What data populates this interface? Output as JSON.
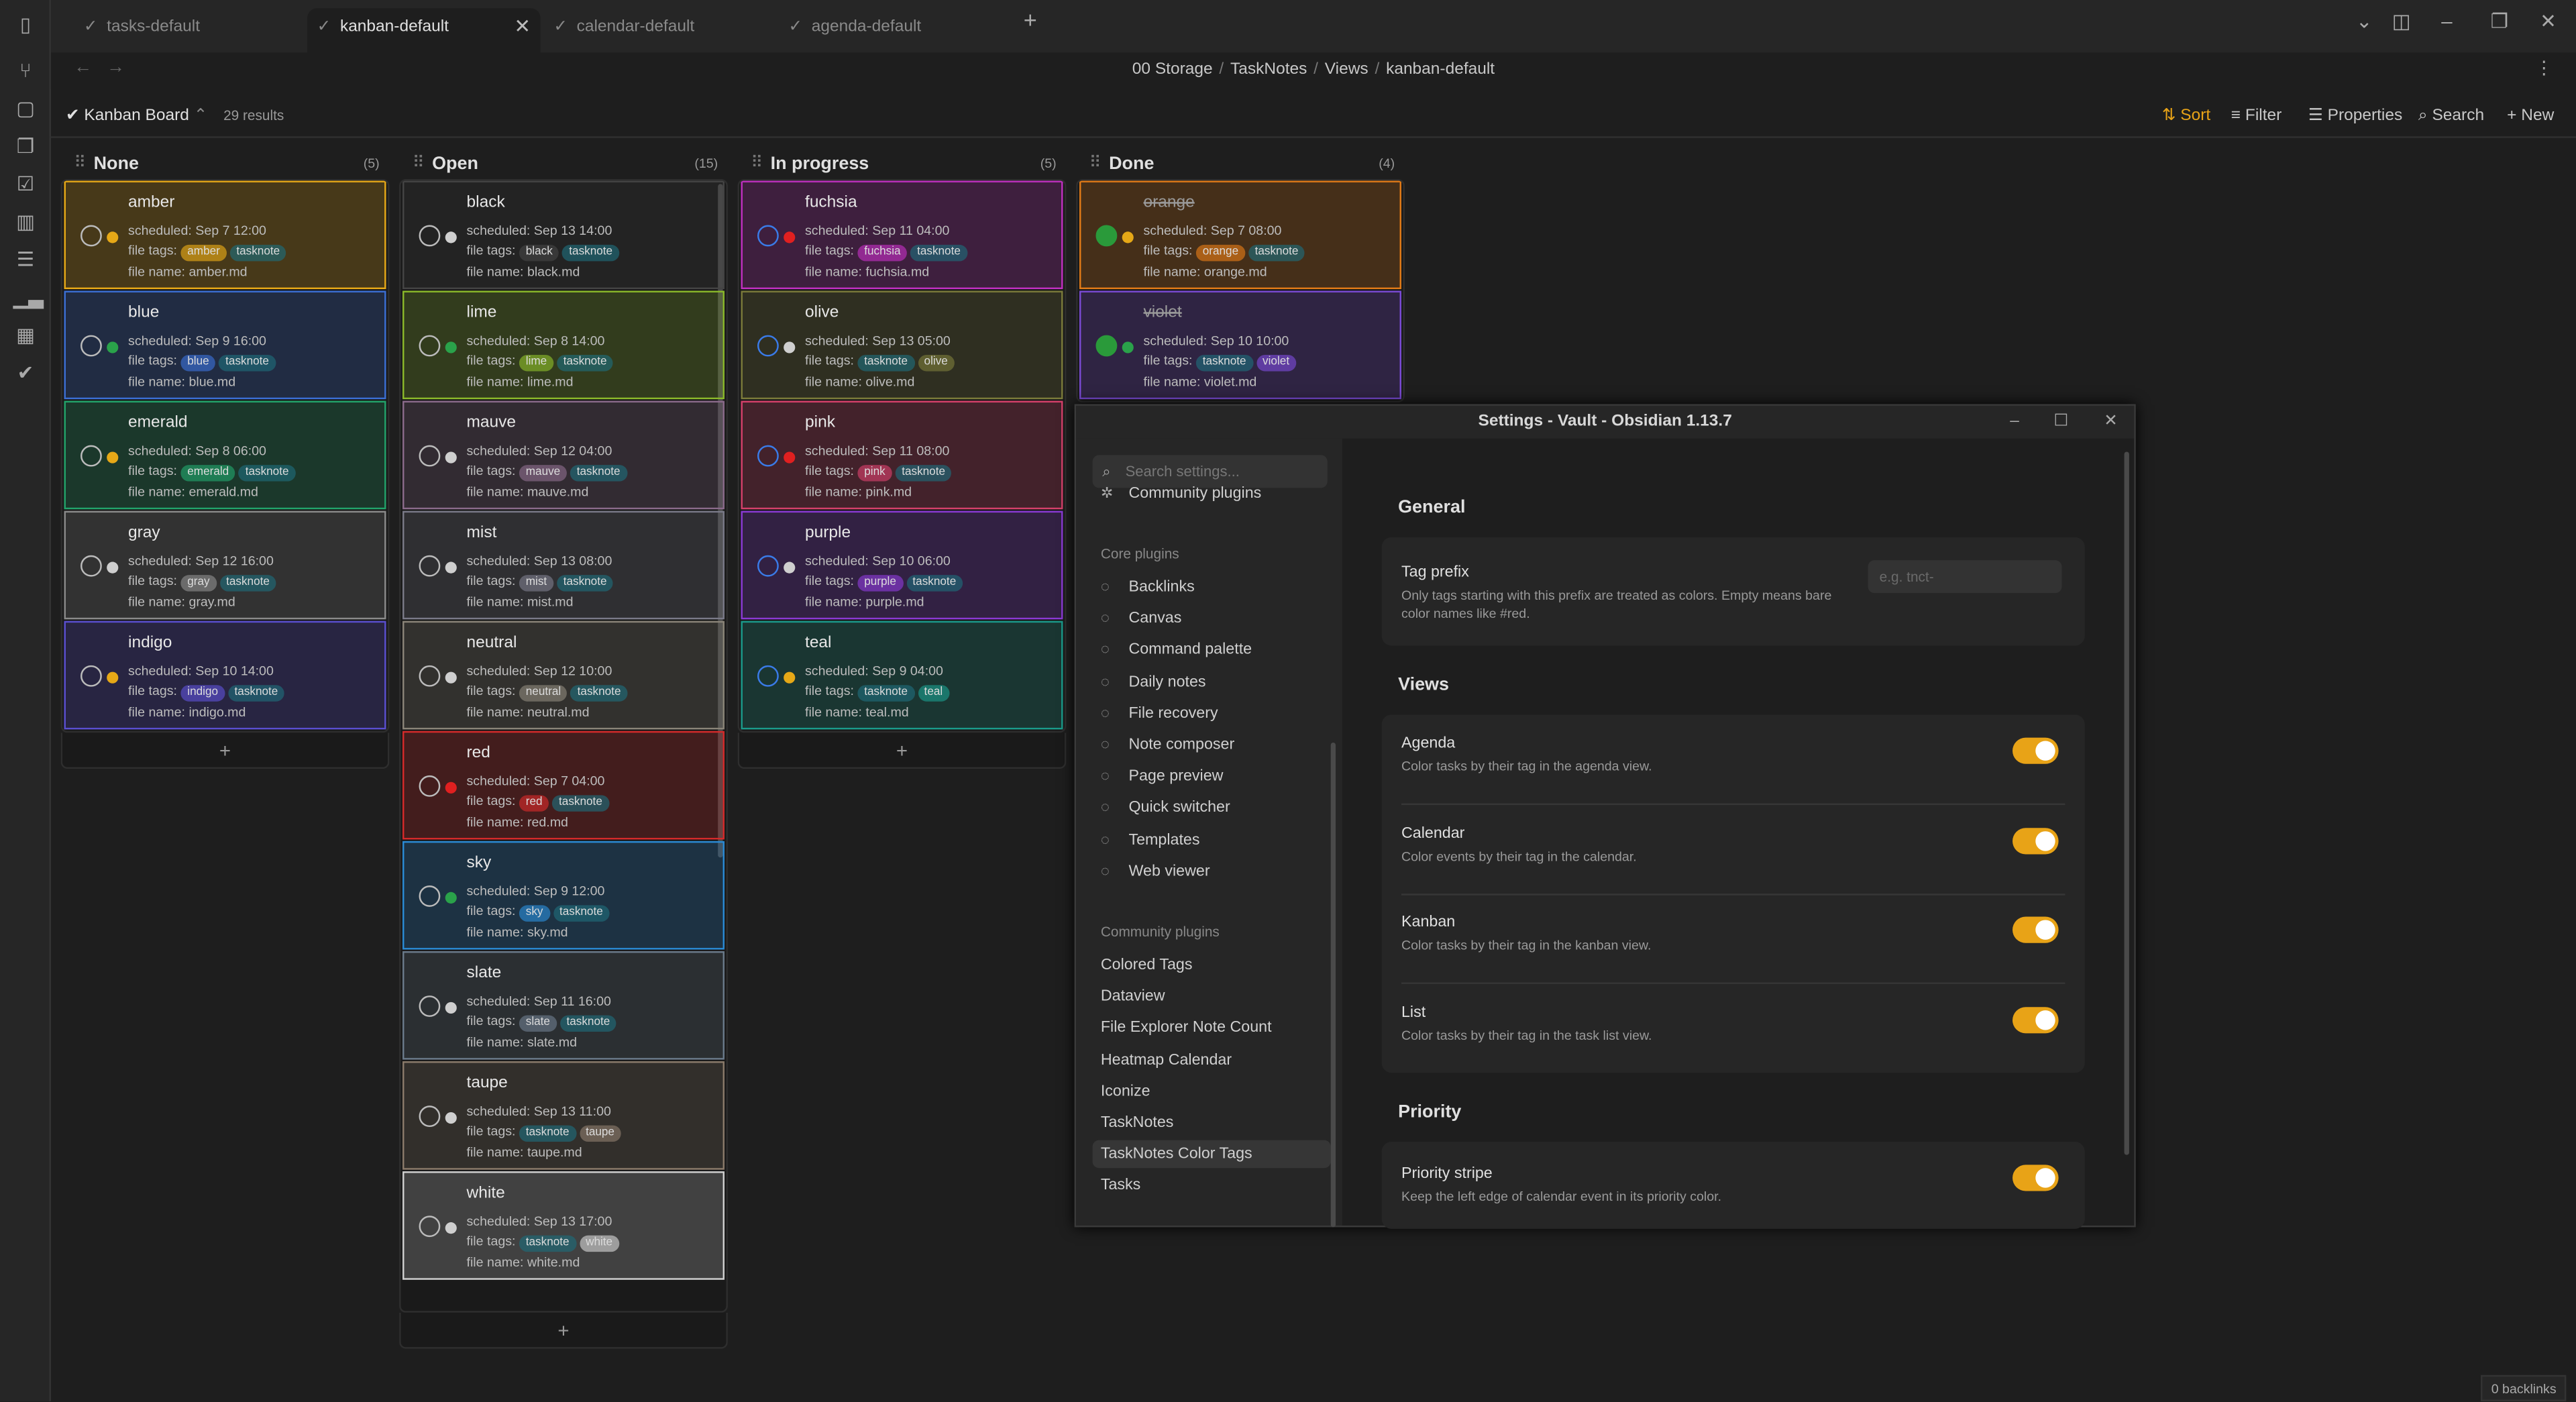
{
  "tabs": [
    {
      "label": "tasks-default"
    },
    {
      "label": "kanban-default"
    },
    {
      "label": "calendar-default"
    },
    {
      "label": "agenda-default"
    }
  ],
  "breadcrumb": [
    "00 Storage",
    "TaskNotes",
    "Views",
    "kanban-default"
  ],
  "toolbar": {
    "view_name": "Kanban Board",
    "results": "29 results",
    "sort": "Sort",
    "filter": "Filter",
    "properties": "Properties",
    "search": "Search",
    "new": "New"
  },
  "card_labels": {
    "scheduled": "scheduled:",
    "file_tags": "file tags:",
    "file_name": "file name:"
  },
  "columns": [
    {
      "title": "None",
      "count": "(5)",
      "cards": [
        {
          "title": "amber",
          "scheduled": "Sep 7 12:00",
          "tags": [
            "amber",
            "tasknote"
          ],
          "file": "amber.md",
          "color": "#e6a817",
          "dot": "#e6a817"
        },
        {
          "title": "blue",
          "scheduled": "Sep 9 16:00",
          "tags": [
            "blue",
            "tasknote"
          ],
          "file": "blue.md",
          "color": "#3b6fd4",
          "dot": "#2aa24a"
        },
        {
          "title": "emerald",
          "scheduled": "Sep 8 06:00",
          "tags": [
            "emerald",
            "tasknote"
          ],
          "file": "emerald.md",
          "color": "#22a36a",
          "dot": "#e6a817"
        },
        {
          "title": "gray",
          "scheduled": "Sep 12 16:00",
          "tags": [
            "gray",
            "tasknote"
          ],
          "file": "gray.md",
          "color": "#8a8a8a",
          "dot": "#cfcfcf"
        },
        {
          "title": "indigo",
          "scheduled": "Sep 10 14:00",
          "tags": [
            "indigo",
            "tasknote"
          ],
          "file": "indigo.md",
          "color": "#5a4fd0",
          "dot": "#e6a817"
        }
      ]
    },
    {
      "title": "Open",
      "count": "(15)",
      "cards": [
        {
          "title": "black",
          "scheduled": "Sep 13 14:00",
          "tags": [
            "black",
            "tasknote"
          ],
          "file": "black.md",
          "color": "#444444",
          "dot": "#cfcfcf"
        },
        {
          "title": "lime",
          "scheduled": "Sep 8 14:00",
          "tags": [
            "lime",
            "tasknote"
          ],
          "file": "lime.md",
          "color": "#8ab82a",
          "dot": "#2aa24a"
        },
        {
          "title": "mauve",
          "scheduled": "Sep 12 04:00",
          "tags": [
            "mauve",
            "tasknote"
          ],
          "file": "mauve.md",
          "color": "#8a6a8a",
          "dot": "#cfcfcf"
        },
        {
          "title": "mist",
          "scheduled": "Sep 13 08:00",
          "tags": [
            "mist",
            "tasknote"
          ],
          "file": "mist.md",
          "color": "#7a7a88",
          "dot": "#cfcfcf"
        },
        {
          "title": "neutral",
          "scheduled": "Sep 12 10:00",
          "tags": [
            "neutral",
            "tasknote"
          ],
          "file": "neutral.md",
          "color": "#8a8478",
          "dot": "#cfcfcf"
        },
        {
          "title": "red",
          "scheduled": "Sep 7 04:00",
          "tags": [
            "red",
            "tasknote"
          ],
          "file": "red.md",
          "color": "#d42a2a",
          "dot": "#e02020"
        },
        {
          "title": "sky",
          "scheduled": "Sep 9 12:00",
          "tags": [
            "sky",
            "tasknote"
          ],
          "file": "sky.md",
          "color": "#2a8ad4",
          "dot": "#2aa24a"
        },
        {
          "title": "slate",
          "scheduled": "Sep 11 16:00",
          "tags": [
            "slate",
            "tasknote"
          ],
          "file": "slate.md",
          "color": "#6a7a8a",
          "dot": "#cfcfcf"
        },
        {
          "title": "taupe",
          "scheduled": "Sep 13 11:00",
          "tags": [
            "tasknote",
            "taupe"
          ],
          "file": "taupe.md",
          "color": "#8a7a6a",
          "dot": "#cfcfcf"
        },
        {
          "title": "white",
          "scheduled": "Sep 13 17:00",
          "tags": [
            "tasknote",
            "white"
          ],
          "file": "white.md",
          "color": "#cfcfcf",
          "dot": "#cfcfcf"
        }
      ]
    },
    {
      "title": "In progress",
      "count": "(5)",
      "cards": [
        {
          "title": "fuchsia",
          "scheduled": "Sep 11 04:00",
          "tags": [
            "fuchsia",
            "tasknote"
          ],
          "file": "fuchsia.md",
          "color": "#c030c0",
          "dot": "#e02020"
        },
        {
          "title": "olive",
          "scheduled": "Sep 13 05:00",
          "tags": [
            "tasknote",
            "olive"
          ],
          "file": "olive.md",
          "color": "#7a7a3a",
          "dot": "#cfcfcf"
        },
        {
          "title": "pink",
          "scheduled": "Sep 11 08:00",
          "tags": [
            "pink",
            "tasknote"
          ],
          "file": "pink.md",
          "color": "#d4406a",
          "dot": "#e02020"
        },
        {
          "title": "purple",
          "scheduled": "Sep 10 06:00",
          "tags": [
            "purple",
            "tasknote"
          ],
          "file": "purple.md",
          "color": "#8a3ad4",
          "dot": "#cfcfcf"
        },
        {
          "title": "teal",
          "scheduled": "Sep 9 04:00",
          "tags": [
            "tasknote",
            "teal"
          ],
          "file": "teal.md",
          "color": "#1a9a8a",
          "dot": "#e6a817"
        }
      ]
    },
    {
      "title": "Done",
      "count": "(4)",
      "cards": [
        {
          "title": "orange",
          "scheduled": "Sep 7 08:00",
          "tags": [
            "orange",
            "tasknote"
          ],
          "file": "orange.md",
          "color": "#e07a17",
          "dot": "#e6a817",
          "done": true
        },
        {
          "title": "violet",
          "scheduled": "Sep 10 10:00",
          "tags": [
            "tasknote",
            "violet"
          ],
          "file": "violet.md",
          "color": "#7a4ad4",
          "dot": "#2aa24a",
          "done": true
        }
      ]
    }
  ],
  "settings": {
    "title": "Settings - Vault - Obsidian 1.13.7",
    "search_placeholder": "Search settings...",
    "top_item": "Community plugins",
    "core_group": "Core plugins",
    "core_items": [
      {
        "label": "Backlinks",
        "icon": "link-icon"
      },
      {
        "label": "Canvas",
        "icon": "canvas-icon"
      },
      {
        "label": "Command palette",
        "icon": "terminal-icon"
      },
      {
        "label": "Daily notes",
        "icon": "calendar-icon"
      },
      {
        "label": "File recovery",
        "icon": "history-icon"
      },
      {
        "label": "Note composer",
        "icon": "merge-icon"
      },
      {
        "label": "Page preview",
        "icon": "preview-icon"
      },
      {
        "label": "Quick switcher",
        "icon": "switcher-icon"
      },
      {
        "label": "Templates",
        "icon": "template-icon"
      },
      {
        "label": "Web viewer",
        "icon": "globe-icon"
      }
    ],
    "community_group": "Community plugins",
    "community_items": [
      "Colored Tags",
      "Dataview",
      "File Explorer Note Count",
      "Heatmap Calendar",
      "Iconize",
      "TaskNotes",
      "TaskNotes Color Tags",
      "Tasks"
    ],
    "selected": "TaskNotes Color Tags",
    "general_heading": "General",
    "tag_prefix": {
      "name": "Tag prefix",
      "desc": "Only tags starting with this prefix are treated as colors. Empty means bare color names like #red.",
      "placeholder": "e.g. tnct-"
    },
    "views_heading": "Views",
    "views": [
      {
        "name": "Agenda",
        "desc": "Color tasks by their tag in the agenda view."
      },
      {
        "name": "Calendar",
        "desc": "Color events by their tag in the calendar."
      },
      {
        "name": "Kanban",
        "desc": "Color tasks by their tag in the kanban view."
      },
      {
        "name": "List",
        "desc": "Color tasks by their tag in the task list view."
      }
    ],
    "priority_heading": "Priority",
    "priority": {
      "name": "Priority stripe",
      "desc": "Keep the left edge of calendar event in its priority color."
    }
  },
  "status_bar": {
    "backlinks": "0 backlinks"
  },
  "colors": {
    "accent": "#e8a317",
    "checkbox_blue": "#3a7be8",
    "done_green": "#2a9a3a"
  }
}
